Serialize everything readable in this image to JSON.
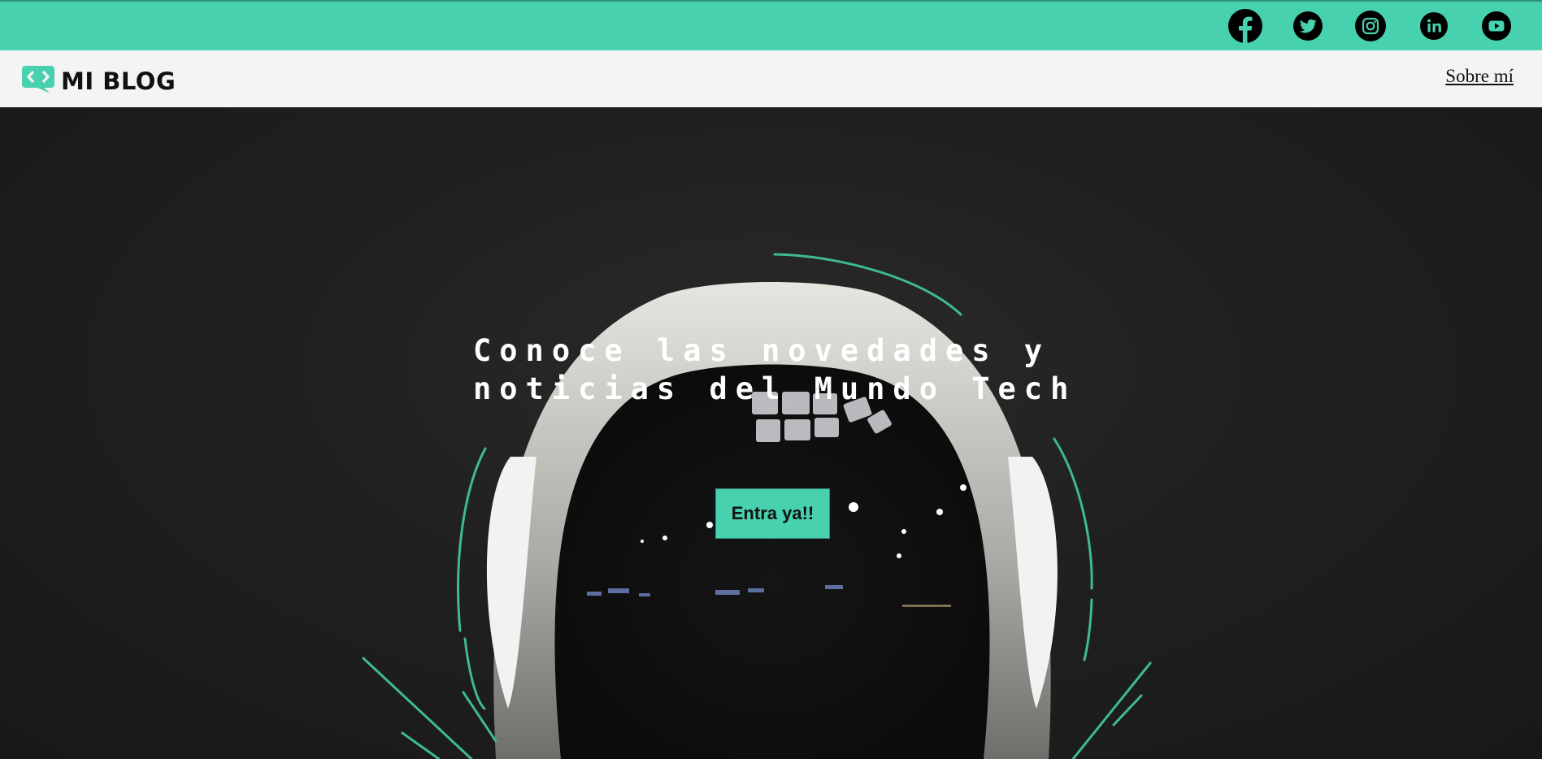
{
  "colors": {
    "accent": "#48d1ae",
    "nav_background": "#f4f4f4",
    "hero_background": "#1c1c1c",
    "text_dark": "#111111",
    "text_light": "#ffffff"
  },
  "social": [
    {
      "icon": "facebook-icon"
    },
    {
      "icon": "twitter-icon"
    },
    {
      "icon": "instagram-icon"
    },
    {
      "icon": "linkedin-icon"
    },
    {
      "icon": "youtube-icon"
    }
  ],
  "header": {
    "logo_icon": "code-chat-bubble-icon",
    "logo_text": "MI BLOG",
    "nav_link": "Sobre mí"
  },
  "hero": {
    "background_image": "astronaut-helmet-illustration",
    "title": "Conoce las novedades y noticias del Mundo Tech",
    "cta_label": "Entra ya!!"
  }
}
